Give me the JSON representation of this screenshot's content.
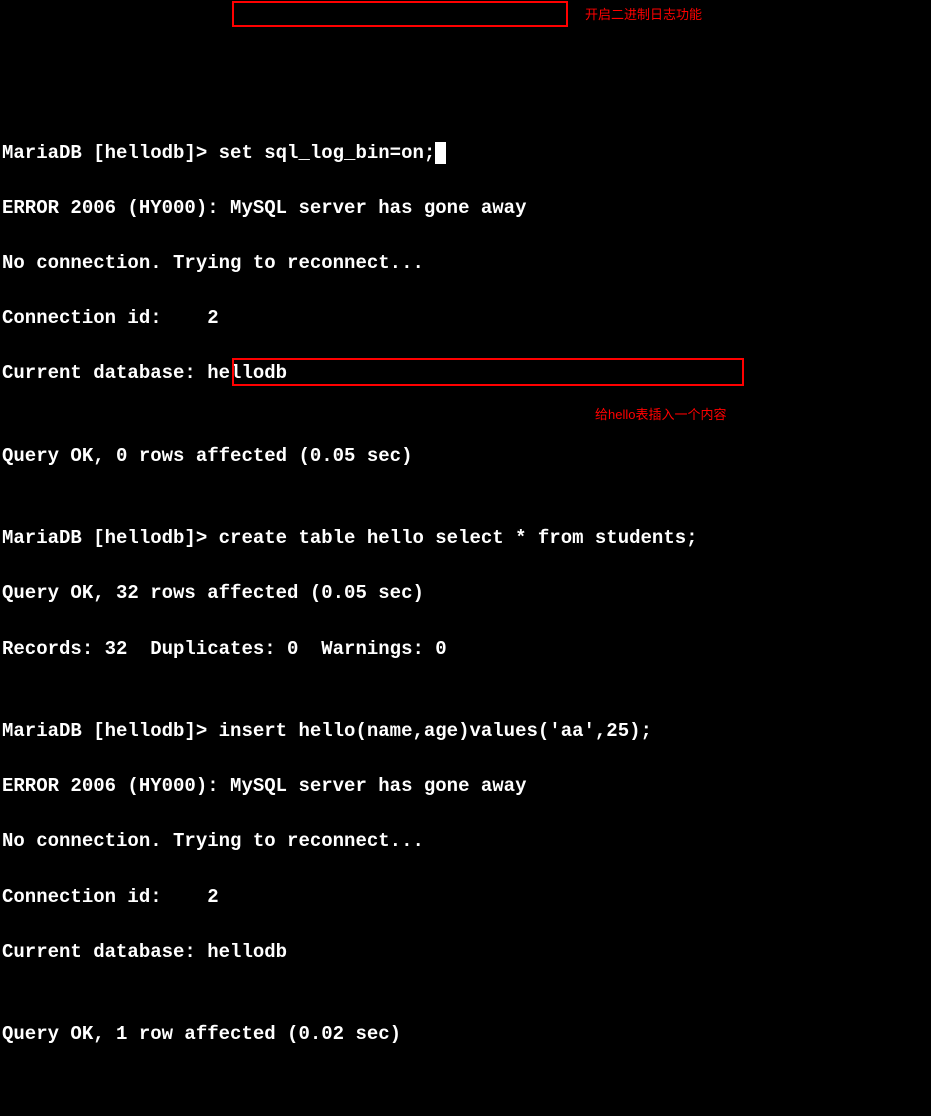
{
  "annotations": {
    "box1_label": "开启二进制日志功能",
    "box2_label": "给hello表插入一个内容"
  },
  "lines": {
    "l1_prompt": "MariaDB [hellodb]> ",
    "l1_cmd": "set sql_log_bin=on;",
    "l2": "ERROR 2006 (HY000): MySQL server has gone away",
    "l3": "No connection. Trying to reconnect...",
    "l4": "Connection id:    2",
    "l5": "Current database: hellodb",
    "l6": "",
    "l7": "Query OK, 0 rows affected (0.05 sec)",
    "l8": "",
    "l9_prompt": "MariaDB [hellodb]> ",
    "l9_cmd": "create table hello select * from students;",
    "l10": "Query OK, 32 rows affected (0.05 sec)",
    "l11": "Records: 32  Duplicates: 0  Warnings: 0",
    "l12": "",
    "l13_prompt": "MariaDB [hellodb]> ",
    "l13_cmd": "insert hello(name,age)values('aa',25);",
    "l14": "ERROR 2006 (HY000): MySQL server has gone away",
    "l15": "No connection. Trying to reconnect...",
    "l16": "Connection id:    2",
    "l17": "Current database: hellodb",
    "l18": "",
    "l19": "Query OK, 1 row affected (0.02 sec)"
  }
}
